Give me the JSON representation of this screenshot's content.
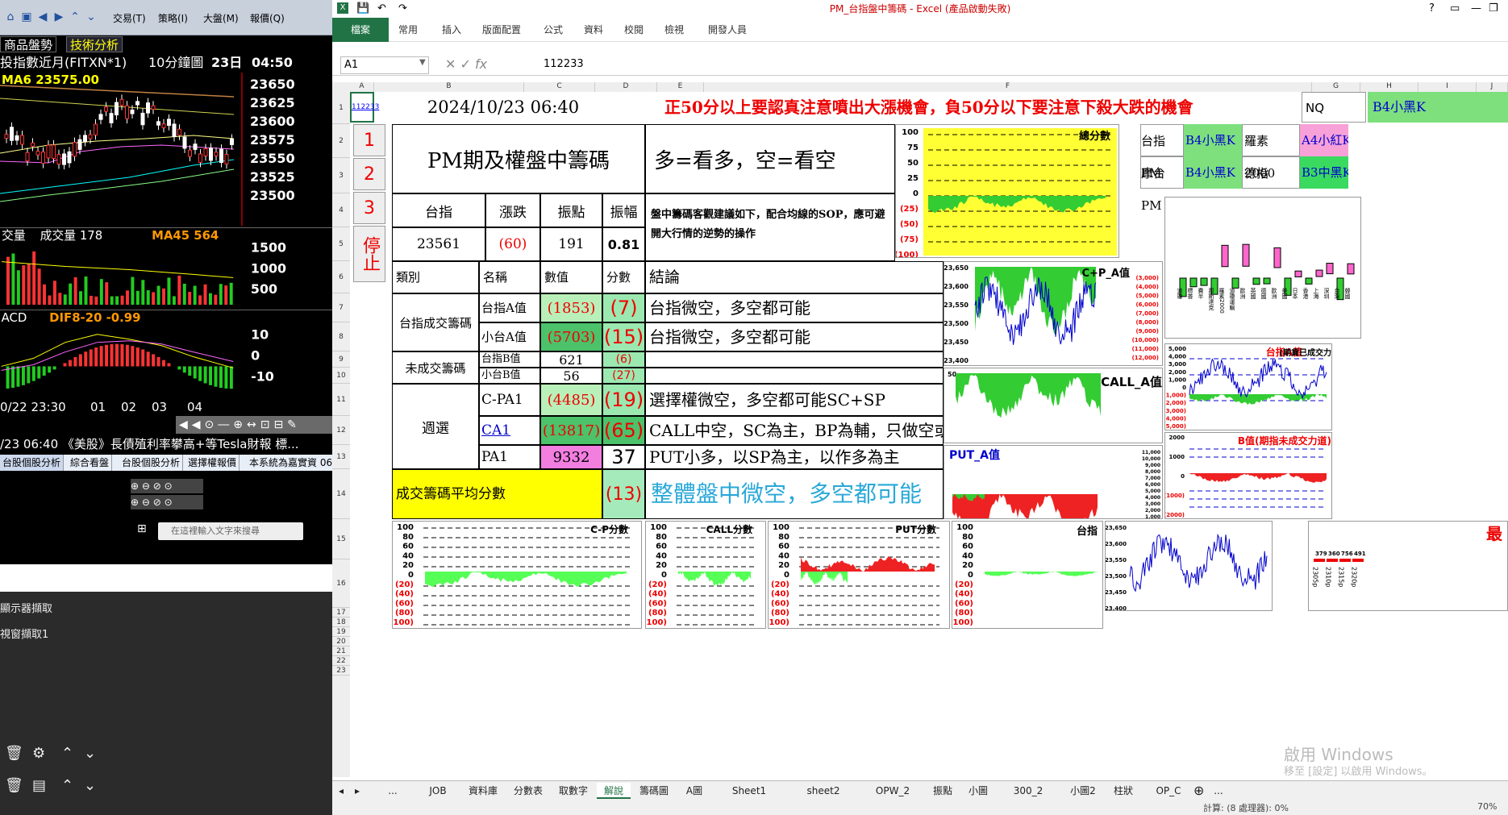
{
  "left": {
    "menu": [
      "交易(T)",
      "策略(I)",
      "大盤(M)",
      "報價(Q)"
    ],
    "tabs": [
      "商品盤勢",
      "技術分析"
    ],
    "instrument": "投指數近月(FITXN*1)",
    "interval": "10分鐘圖",
    "day": "23日",
    "time": "04:50",
    "ma6": "MA6 23575.00",
    "price_ticks": [
      "23650",
      "23625",
      "23600",
      "23575",
      "23550",
      "23525",
      "23500"
    ],
    "vol_label": "交量",
    "vol_value": "成交量 178",
    "ma45": "MA45 564",
    "vol_ticks": [
      "1500",
      "1000",
      "500"
    ],
    "macd_label": "ACD",
    "dif": "DIF8-20 -0.99",
    "macd_ticks": [
      "10",
      "0",
      "-10"
    ],
    "time_axis": [
      "0/22 23:30",
      "01",
      "02",
      "03",
      "04"
    ],
    "news": "/23 06:40 《美股》長債殖利率攀高+等Tesla財報 標...",
    "news_tabs": [
      "台股個股分析",
      "綜合看盤",
      "台股個股分析",
      "選擇權報價",
      "本系統為嘉實資 06"
    ],
    "search_placeholder": "在這裡輸入文字來搜尋",
    "capture1": "顯示器擷取",
    "capture2": "視窗擷取1"
  },
  "excel": {
    "title": "PM_台指盤中籌碼 - Excel (產品啟動失敗)",
    "ribbon_tabs": [
      "檔案",
      "常用",
      "插入",
      "版面配置",
      "公式",
      "資料",
      "校閱",
      "檢視",
      "開發人員"
    ],
    "name_box": "A1",
    "formula_value": "112233",
    "col_letters": [
      "A",
      "B",
      "C",
      "D",
      "E",
      "F",
      "G",
      "H",
      "I",
      "J"
    ],
    "row_numbers": [
      "1",
      "2",
      "3",
      "4",
      "5",
      "6",
      "7",
      "8",
      "9",
      "10",
      "11",
      "12",
      "13",
      "14",
      "15",
      "16",
      "17",
      "18",
      "19",
      "20",
      "21",
      "22",
      "23"
    ],
    "a1": "112233",
    "datetime": "2024/10/23  06:40",
    "warning": "正50分以上要認真注意噴出大漲機會，負50分以下要注意下殺大跌的機會",
    "nq": "NQ",
    "b4_black": "B4小黑K",
    "side_buttons": [
      "1",
      "2",
      "3",
      "停止"
    ],
    "main_title": "PM期及權盤中籌碼",
    "long_short": "多=看多，空=看空",
    "hdr_index": "台指",
    "hdr_change": "漲跌",
    "hdr_range": "振點",
    "hdr_amp": "振幅",
    "val_index": "23561",
    "val_change": "(60)",
    "val_range": "191",
    "val_amp": "0.81",
    "advice": "盤中籌碼客觀建議如下，配合均線的SOP，應可避開大行情的逆勢的操作",
    "col_category": "類別",
    "col_name": "名稱",
    "col_value": "數值",
    "col_score": "分數",
    "col_conclusion": "結論",
    "cat_traded": "台指成交籌碼",
    "cat_untraded": "未成交籌碼",
    "cat_weekly": "週選",
    "avg_label": "成交籌碼平均分數",
    "rows": [
      {
        "name": "台指A值",
        "value": "(1853)",
        "score": "(7)",
        "conclusion": "台指微空，多空都可能"
      },
      {
        "name": "小台A值",
        "value": "(5703)",
        "score": "(15)",
        "conclusion": "台指微空，多空都可能"
      },
      {
        "name": "台指B值",
        "value": "621",
        "score": "(6)",
        "conclusion": ""
      },
      {
        "name": "小台B值",
        "value": "56",
        "score": "(27)",
        "conclusion": ""
      },
      {
        "name": "C-PA1",
        "value": "(4485)",
        "score": "(19)",
        "conclusion": "選擇權微空，多空都可能SC+SP"
      },
      {
        "name": "CA1",
        "value": "(13817)",
        "score": "(65)",
        "conclusion": "CALL中空，SC為主，BP為輔，只做空或"
      },
      {
        "name": "PA1",
        "value": "9332",
        "score": "37",
        "conclusion": "PUT小多，以SP為主，以作多為主"
      }
    ],
    "avg_score": "(13)",
    "avg_conclusion": "整體盤中微空，多空都可能",
    "right_panel": {
      "r1": [
        "台指PM",
        "B4小黑K",
        "羅素2000",
        "A4小紅K"
      ],
      "r2": [
        "摩台PM",
        "B4小黑K",
        "德指",
        "B3中黑K"
      ]
    },
    "sheet_tabs": [
      "...",
      "JOB",
      "資料庫",
      "分數表",
      "取數字",
      "解說",
      "籌碼圖",
      "A圖",
      "Sheet1",
      "sheet2",
      "OPW_2",
      "振點",
      "小圖",
      "300_2",
      "小圖2",
      "柱狀",
      "OP_C",
      "..."
    ],
    "active_sheet": "解說",
    "status": "計算: (8 處理器): 0%",
    "zoom": "70%",
    "watermark1": "啟用 Windows",
    "watermark2": "移至 [設定] 以啟用 Windows。"
  },
  "chart_data": [
    {
      "type": "area",
      "title": "總分數",
      "ylim": [
        -100,
        100
      ],
      "yticks": [
        "100",
        "75",
        "50",
        "25",
        "0",
        "(25)",
        "(50)",
        "(75)",
        "(100)"
      ]
    },
    {
      "type": "area",
      "title": "C+P_A值",
      "yticks_left": [
        "23,650",
        "23,600",
        "23,550",
        "23,500",
        "23,450",
        "23,400"
      ],
      "yticks_right": [
        "(3,000)",
        "(4,000)",
        "(5,000)",
        "(6,000)",
        "(7,000)",
        "(8,000)",
        "(9,000)",
        "(10,000)",
        "(11,000)",
        "(12,000)"
      ]
    },
    {
      "type": "area",
      "title": "CALL_A值",
      "yticks": [
        "50"
      ]
    },
    {
      "type": "area",
      "title": "PUT_A值",
      "yticks_right": [
        "11,000",
        "10,000",
        "9,000",
        "8,000",
        "7,000",
        "6,000",
        "5,000",
        "4,000",
        "3,000",
        "2,000",
        "1,000"
      ]
    },
    {
      "type": "line",
      "title": "台指A值",
      "subtitle": "(期貨已成交力",
      "yticks": [
        "5,000",
        "4,000",
        "3,000",
        "2,000",
        "1,000",
        "0",
        "(1,000)",
        "(2,000)",
        "(3,000)",
        "(4,000)",
        "(5,000)"
      ]
    },
    {
      "type": "area",
      "title": "B值(期指未成交力道)",
      "yticks": [
        "2000",
        "1000",
        "0",
        "(1000)",
        "(2000)"
      ]
    },
    {
      "type": "area",
      "title": "C-P分數",
      "yticks": [
        "100",
        "80",
        "60",
        "40",
        "20",
        "0",
        "(20)",
        "(40)",
        "(60)",
        "(80)",
        "(100)"
      ]
    },
    {
      "type": "area",
      "title": "CALL分數"
    },
    {
      "type": "area",
      "title": "PUT分數"
    },
    {
      "type": "area",
      "title": "台指"
    },
    {
      "type": "line",
      "title": "",
      "yticks": [
        "23,650",
        "23,600",
        "23,550",
        "23,500",
        "23,450",
        "23,400"
      ]
    },
    {
      "type": "bar",
      "title": "",
      "categories": [
        "道瓊",
        "標普",
        "費半",
        "那斯達克",
        "羅素2000",
        "道瓊運輸",
        "歐洲",
        "英國",
        "德國",
        "歐洲",
        "美國",
        "日本",
        "香港",
        "上海",
        "深圳",
        "台灣",
        "韓國"
      ]
    },
    {
      "type": "bar",
      "title": "最",
      "values_labels": [
        "379",
        "360",
        "756",
        "491"
      ],
      "categories": [
        "2305p",
        "2310p",
        "2315p",
        "2320p"
      ]
    }
  ]
}
